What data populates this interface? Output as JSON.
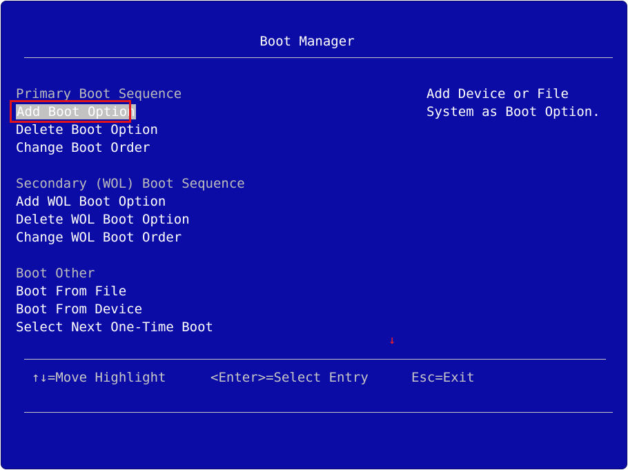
{
  "title": "Boot Manager",
  "menu": {
    "primary": {
      "header": "Primary Boot Sequence",
      "items": [
        "Add Boot Option",
        "Delete Boot Option",
        "Change Boot Order"
      ]
    },
    "secondary": {
      "header": "Secondary (WOL) Boot Sequence",
      "items": [
        "Add WOL Boot Option",
        "Delete WOL Boot Option",
        "Change WOL Boot Order"
      ]
    },
    "other": {
      "header": "Boot Other",
      "items": [
        "Boot From File",
        "Boot From Device",
        "Select Next One-Time Boot"
      ]
    },
    "selected": "Add Boot Option"
  },
  "help": {
    "line1": "Add Device or File",
    "line2": "System as Boot Option."
  },
  "scroll_indicator": "↓",
  "footer": {
    "move": "↑↓=Move Highlight",
    "select": "<Enter>=Select Entry",
    "exit": "Esc=Exit"
  },
  "colors": {
    "background": "#0b0ba5",
    "highlight": "#c2c2c2",
    "selection_outline": "#e0141c"
  }
}
